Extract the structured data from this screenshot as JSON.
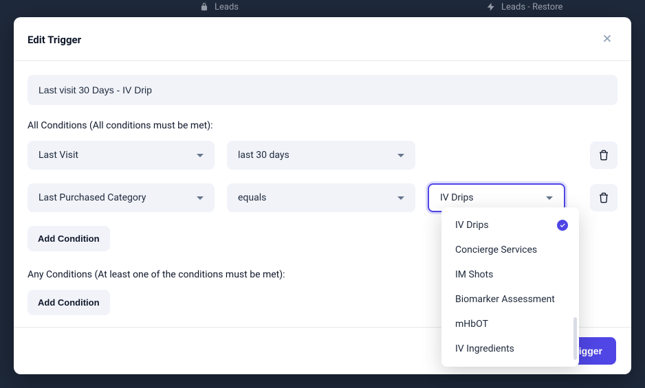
{
  "background": {
    "pill1": {
      "icon": "lock",
      "label": "Leads"
    },
    "pill2": {
      "icon": "bolt",
      "label": "Leads - Restore"
    }
  },
  "modal": {
    "title": "Edit Trigger",
    "name_value": "Last visit 30 Days - IV Drip",
    "all_conditions_label": "All Conditions (All conditions must be met):",
    "any_conditions_label": "Any Conditions (At least one of the conditions must be met):",
    "add_condition_label": "Add Condition",
    "save_label": "Save trigger"
  },
  "conditions": {
    "row1": {
      "field": "Last Visit",
      "operator": "last 30 days"
    },
    "row2": {
      "field": "Last Purchased Category",
      "operator": "equals",
      "value": "IV Drips"
    }
  },
  "dropdown_options": [
    {
      "label": "IV Drips",
      "selected": true
    },
    {
      "label": "Concierge Services",
      "selected": false
    },
    {
      "label": "IM Shots",
      "selected": false
    },
    {
      "label": "Biomarker Assessment",
      "selected": false
    },
    {
      "label": "mHbOT",
      "selected": false
    },
    {
      "label": "IV Ingredients",
      "selected": false
    }
  ]
}
